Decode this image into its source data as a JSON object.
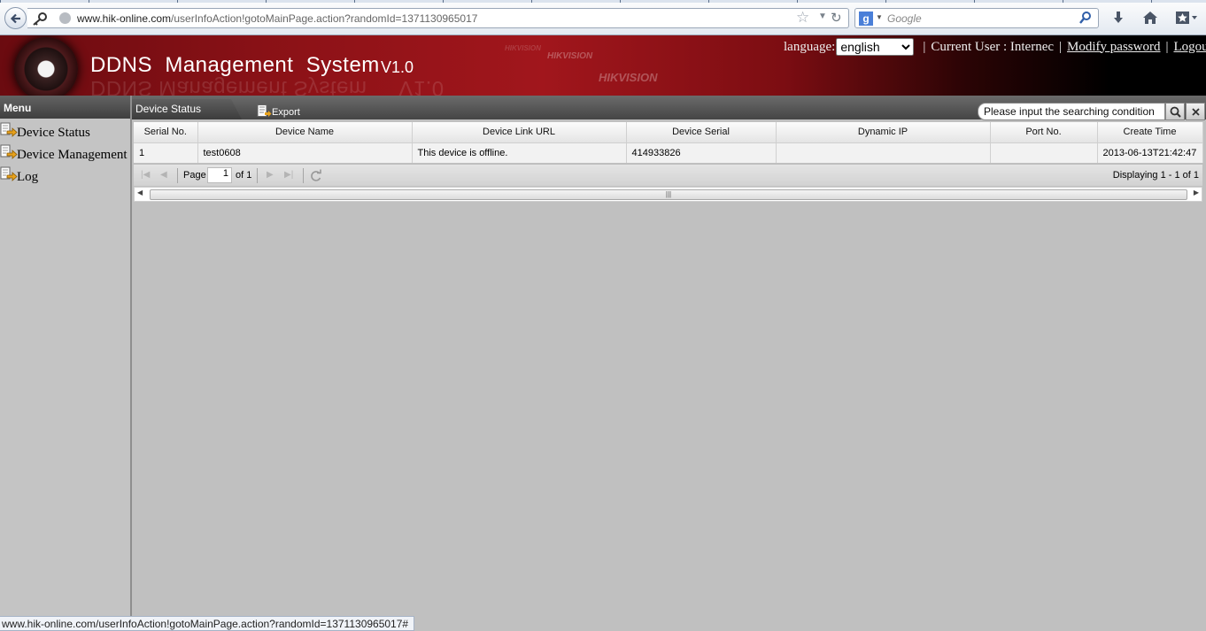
{
  "browser": {
    "url_host": "www.hik-online.com",
    "url_path": "/userInfoAction!gotoMainPage.action?randomId=1371130965017",
    "search_placeholder": "Google",
    "status_url": "www.hik-online.com/userInfoAction!gotoMainPage.action?randomId=1371130965017#"
  },
  "header": {
    "title": "DDNS  Management  System",
    "version": "V1.0",
    "watermark": "HIKVISION",
    "language_label": "language:",
    "language_value": "english",
    "current_user_label": "Current User : Internec",
    "modify_password": "Modify password",
    "logout": "Logout"
  },
  "menu": {
    "title": "Menu",
    "items": [
      {
        "label": "Device Status"
      },
      {
        "label": "Device Management"
      },
      {
        "label": "Log"
      }
    ]
  },
  "panel": {
    "tab_label": "Device Status",
    "export_label": "Export",
    "search_placeholder": "Please input the searching condition"
  },
  "table": {
    "columns": [
      "Serial No.",
      "Device Name",
      "Device Link URL",
      "Device Serial",
      "Dynamic IP",
      "Port No.",
      "Create Time"
    ],
    "rows": [
      [
        "1",
        "test0608",
        "This device is offline.",
        "414933826",
        "",
        "",
        "2013-06-13T21:42:47"
      ]
    ]
  },
  "pager": {
    "page_label": "Page",
    "page_value": "1",
    "of_label": "of 1",
    "displaying": "Displaying 1 - 1 of 1"
  },
  "colors": {
    "header_red": "#a1161c",
    "menu_head": "#4a4a4a",
    "body_gray": "#c0c0c0"
  }
}
